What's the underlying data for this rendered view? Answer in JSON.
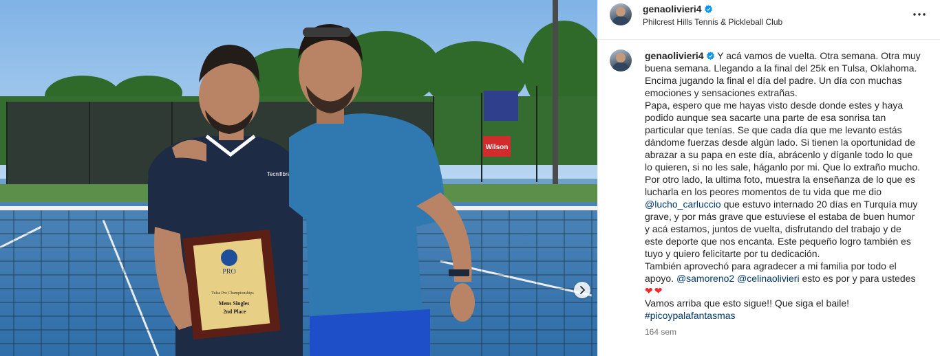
{
  "post": {
    "username": "genaolivieri4",
    "location": "Philcrest Hills Tennis & Pickleball Club",
    "time_ago": "164 sem",
    "caption": {
      "p1": "Y acá vamos de vuelta. Otra semana. Otra muy buena semana. Llegando a la final del 25k en Tulsa, Oklahoma. Encima jugando la final el día del padre. Un día con muchas emociones y sensaciones extrañas.",
      "p2": "Papa, espero que me hayas visto desde donde estes y haya podido aunque sea sacarte una parte de esa sonrisa tan particular que tenías. Se que cada día que me levanto estás dándome fuerzas desde algún lado. Si tienen la oportunidad de abrazar a su papa en este día, abrácenlo y díganle todo lo que lo quieren, si no les sale, háganlo por mi. Que lo extraño mucho.",
      "p3_before": "Por otro lado, la ultima foto, muestra la enseñanza de lo que es lucharla en los peores momentos de tu vida que me dio",
      "mention1": "@lucho_carluccio",
      "p3_after": "que estuvo internado 20 días en Turquía muy grave, y por más grave que estuviese el estaba de buen humor y acá estamos, juntos de vuelta, disfrutando del trabajo y de este deporte que nos encanta. Este pequeño logro también es tuyo y quiero felicitarte por tu dedicación.",
      "p4": "También aprovechó para agradecer a mi familia por todo el apoyo.",
      "mention2": "@samoreno2",
      "mention3": "@celinaolivieri",
      "p4_after": "esto es por y para ustedes",
      "hearts": "❤❤",
      "p5": "Vamos arriba que esto sigue!! Que siga el baile!",
      "hashtag": "#picoypalafantasmas"
    }
  },
  "photo": {
    "plaque_line1": "Tulsa Pro Championships",
    "plaque_line2": "Mens Singles",
    "plaque_line3": "2nd Place",
    "plaque_logo": "PRO",
    "sponsor": "Wilson",
    "shirt_brand": "Tecnifibre"
  },
  "icons": {
    "verified": "verified-badge-icon",
    "more": "more-options-icon",
    "next": "chevron-right-icon"
  },
  "colors": {
    "verified": "#0095f6",
    "link": "#00376b",
    "muted": "#737373"
  }
}
